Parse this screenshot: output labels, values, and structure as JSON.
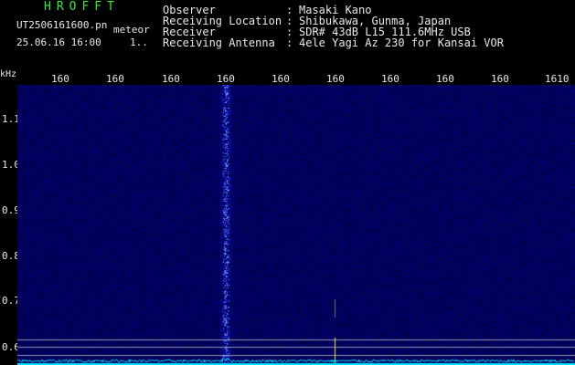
{
  "header": {
    "app_title": "HROFFT",
    "file_name": "UT2506161600.pn",
    "file_tag": "meteor",
    "datetime": "25.06.16 16:00",
    "extra": "1.."
  },
  "info": [
    {
      "label": "Observer",
      "colon": ":",
      "value": "Masaki Kano"
    },
    {
      "label": "Receiving Location",
      "colon": ":",
      "value": "Shibukawa, Gunma, Japan"
    },
    {
      "label": "Receiver",
      "colon": ":",
      "value": "SDR# 43dB L15 111.6MHz USB"
    },
    {
      "label": "Receiving Antenna",
      "colon": ":",
      "value": "4ele Yagi Az 230 for Kansai VOR"
    }
  ],
  "axis": {
    "unit": "kHz",
    "x_ticks": [
      "160",
      "160",
      "160",
      "160",
      "160",
      "160",
      "160",
      "160",
      "160",
      "1610"
    ],
    "y_ticks": [
      "1.1",
      "1.0",
      "0.9",
      "0.8",
      "0.7",
      "0.6"
    ]
  },
  "colors": {
    "background": "#000000",
    "spectrogram_base": "#000050",
    "title_green": "#37e837",
    "trace_cyan": "#00e5ff",
    "marker_yellow": "#e8e84a"
  }
}
